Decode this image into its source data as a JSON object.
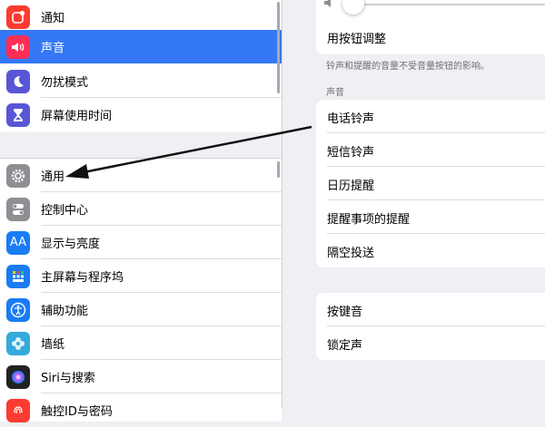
{
  "sidebar": {
    "group1": [
      {
        "label": "通知",
        "icon": "notifications-icon",
        "color": "#fe3b30"
      },
      {
        "label": "声音",
        "icon": "sounds-icon",
        "color": "#fe2d55",
        "selected": true
      },
      {
        "label": "勿扰模式",
        "icon": "moon-icon",
        "color": "#5856d6"
      },
      {
        "label": "屏幕使用时间",
        "icon": "hourglass-icon",
        "color": "#5856d6"
      }
    ],
    "group2": [
      {
        "label": "通用",
        "icon": "gear-icon",
        "color": "#8e8e93"
      },
      {
        "label": "控制中心",
        "icon": "toggles-icon",
        "color": "#8e8e93"
      },
      {
        "label": "显示与亮度",
        "icon": "text-size-icon",
        "color": "#1a7cf5"
      },
      {
        "label": "主屏幕与程序坞",
        "icon": "home-grid-icon",
        "color": "#1a7cf5"
      },
      {
        "label": "辅助功能",
        "icon": "accessibility-icon",
        "color": "#1a7cf5"
      },
      {
        "label": "墙纸",
        "icon": "wallpaper-flower-icon",
        "color": "#34aadc"
      },
      {
        "label": "Siri与搜索",
        "icon": "siri-icon",
        "color": "#222222"
      },
      {
        "label": "触控ID与密码",
        "icon": "fingerprint-icon",
        "color": "#fe3b30"
      }
    ]
  },
  "detail": {
    "button_adjust": "用按钮调整",
    "footnote": "铃声和提醒的音量不受音量按钮的影响。",
    "section_sounds": "声音",
    "sounds": [
      "电话铃声",
      "短信铃声",
      "日历提醒",
      "提醒事项的提醒",
      "隔空投送"
    ],
    "feedback": [
      "按键音",
      "锁定声"
    ]
  },
  "colors": {
    "selected": "#3478f6",
    "background": "#efeff4"
  }
}
